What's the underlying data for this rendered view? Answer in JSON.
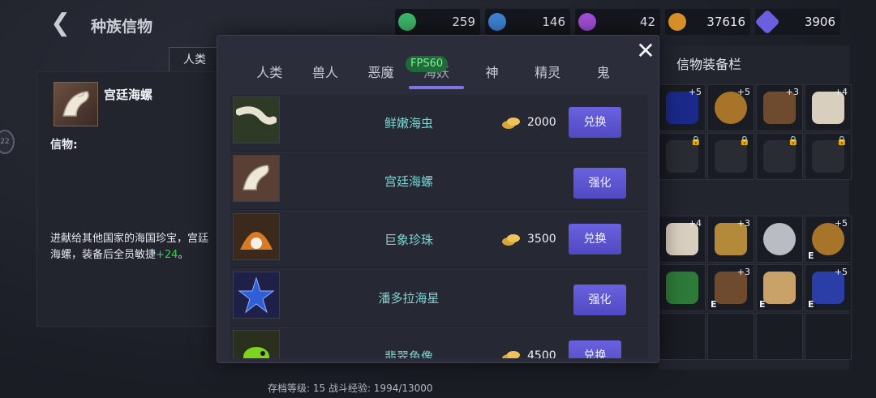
{
  "header": {
    "title": "种族信物"
  },
  "currencies": [
    {
      "icon": "green-potion-icon",
      "value": "259",
      "color": "#3fb86b"
    },
    {
      "icon": "blue-potion-icon",
      "value": "146",
      "color": "#3f84d6"
    },
    {
      "icon": "purple-potion-icon",
      "value": "42",
      "color": "#a34fd9"
    },
    {
      "icon": "gold-coin-icon",
      "value": "37616",
      "color": "#d8902a"
    },
    {
      "icon": "crystal-icon",
      "value": "3906",
      "color": "#6b5fe0"
    }
  ],
  "left_panel": {
    "tab_label": "人类",
    "item_name": "宫廷海螺",
    "trust_label": "信物:",
    "description": "进献给其他国家的海国珍宝，宫廷海螺，装备后全员敏捷",
    "bonus": "+24",
    "bonus_suffix": "。"
  },
  "equip_panel": {
    "title": "信物装备栏",
    "grid1_badges": [
      "+5",
      "+5",
      "+3",
      "+4",
      "",
      "",
      "",
      ""
    ],
    "grid2_badges": [
      "+4",
      "+3",
      "",
      "+5",
      "",
      "+3",
      "",
      "+5"
    ],
    "grid2_e_labels": [
      "",
      "",
      "",
      "E",
      "",
      "E",
      "E",
      "E"
    ]
  },
  "modal": {
    "fps_label": "FPS60",
    "tabs": [
      "人类",
      "兽人",
      "恶魔",
      "海妖",
      "神",
      "精灵",
      "鬼"
    ],
    "active_tab": "海妖",
    "items": [
      {
        "name": "鲜嫩海虫",
        "price": "2000",
        "button": "兑换",
        "icon": "sea-worm-icon"
      },
      {
        "name": "宫廷海螺",
        "price": "",
        "button": "强化",
        "icon": "conch-icon"
      },
      {
        "name": "巨象珍珠",
        "price": "3500",
        "button": "兑换",
        "icon": "pearl-icon"
      },
      {
        "name": "潘多拉海星",
        "price": "",
        "button": "强化",
        "icon": "starfish-icon"
      },
      {
        "name": "翡翠鱼像",
        "price": "4500",
        "button": "兑换",
        "icon": "fish-statue-icon"
      }
    ]
  },
  "footer": {
    "text": "存档等级: 15  战斗经验: 1994/13000"
  }
}
